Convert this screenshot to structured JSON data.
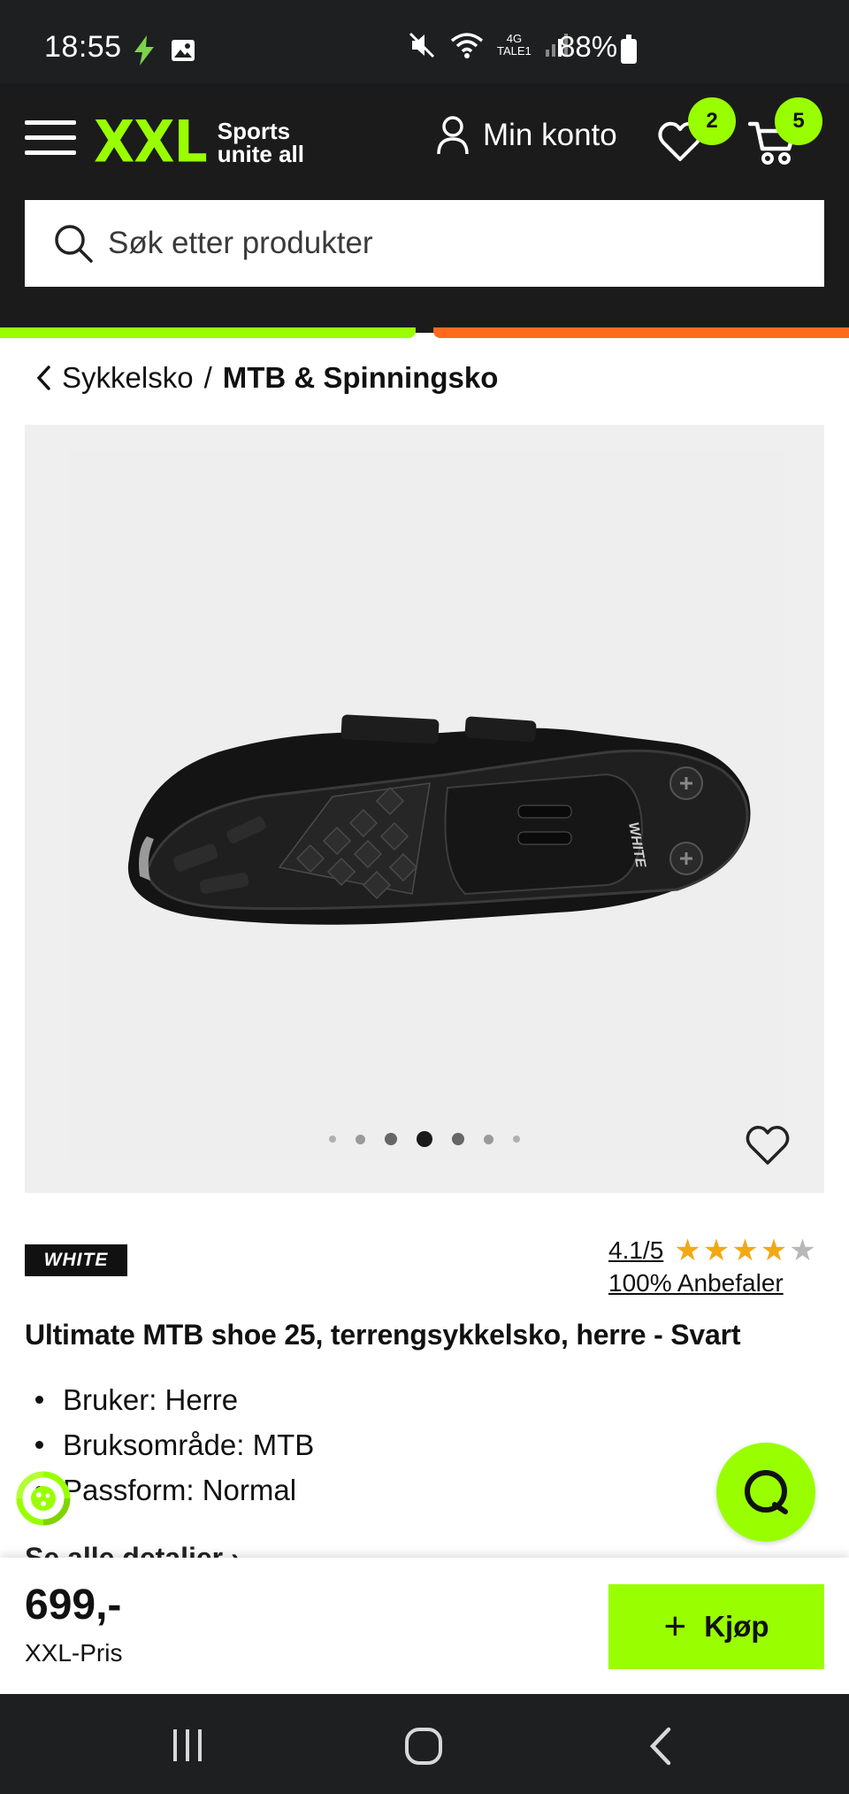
{
  "status_bar": {
    "time": "18:55",
    "network": "4G",
    "carrier_short": "TALE1",
    "battery": "88%"
  },
  "header": {
    "logo_mark": "XXL",
    "logo_tagline_1": "Sports",
    "logo_tagline_2": "unite all",
    "account_label": "Min konto",
    "wishlist_count": "2",
    "cart_count": "5",
    "brand_color": "#99ff00",
    "accent_orange": "#ff6b1a"
  },
  "search": {
    "placeholder": "Søk etter produkter"
  },
  "breadcrumb": {
    "parent": "Sykkelsko",
    "separator": "/",
    "current": "MTB & Spinningsko"
  },
  "gallery": {
    "image_count": 7,
    "active_index": 3
  },
  "product": {
    "brand": "WHITE",
    "rating": "4.1/5",
    "rating_value": 4.1,
    "rating_max": 5,
    "recommend": "100% Anbefaler",
    "title": "Ultimate MTB shoe 25, terrengsykkelsko, herre - Svart",
    "features": [
      "Bruker: Herre",
      "Bruksområde: MTB",
      "Passform: Normal"
    ],
    "see_all": "Se alle detaljer ›"
  },
  "buy_bar": {
    "price": "699,-",
    "price_label": "XXL-Pris",
    "buy_label": "Kjøp"
  }
}
